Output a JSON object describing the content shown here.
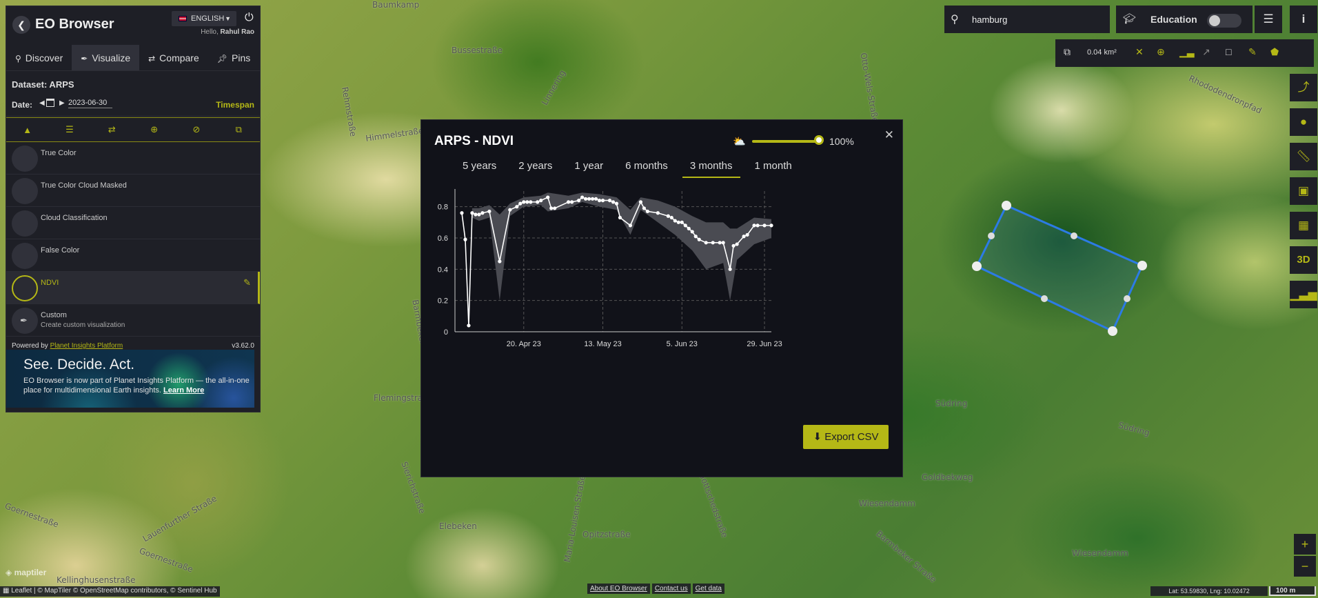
{
  "app": {
    "title": "EO Browser",
    "language": "ENGLISH",
    "greeting_prefix": "Hello,",
    "user_name": "Rahul Rao"
  },
  "tabs": [
    {
      "icon": "search-icon",
      "label": "Discover"
    },
    {
      "icon": "brush-icon",
      "label": "Visualize"
    },
    {
      "icon": "compare-icon",
      "label": "Compare"
    },
    {
      "icon": "pin-icon",
      "label": "Pins"
    }
  ],
  "dataset": {
    "label": "Dataset: ARPS"
  },
  "date": {
    "label": "Date:",
    "value": "2023-06-30",
    "timespan_label": "Timespan"
  },
  "layers": [
    {
      "name": "True Color"
    },
    {
      "name": "True Color Cloud Masked"
    },
    {
      "name": "Cloud Classification"
    },
    {
      "name": "False Color"
    },
    {
      "name": "NDVI",
      "selected": true
    },
    {
      "name": "Custom",
      "subtitle": "Create custom visualization"
    }
  ],
  "powered": {
    "prefix": "Powered by",
    "link": "Planet Insights Platform",
    "version": "v3.62.0"
  },
  "promo": {
    "headline": "See. Decide. Act.",
    "text": "EO Browser is now part of Planet Insights Platform — the all-in-one place for multidimensional Earth insights.",
    "link": "Learn More"
  },
  "search": {
    "value": "hamburg"
  },
  "education": {
    "label": "Education",
    "enabled": false
  },
  "toolbar": {
    "area": "0.04 km²"
  },
  "modal": {
    "title": "ARPS - NDVI",
    "cloud_coverage": "100%",
    "cloud_coverage_fraction": 1.0,
    "ranges": [
      "5 years",
      "2 years",
      "1 year",
      "6 months",
      "3 months",
      "1 month"
    ],
    "active_range": "3 months",
    "export_label": "Export CSV"
  },
  "chart_data": {
    "type": "line",
    "title": "",
    "xlabel": "",
    "ylabel": "",
    "ylim": [
      0,
      0.9
    ],
    "yticks": [
      "0",
      "0.2",
      "0.4",
      "0.6",
      "0.8"
    ],
    "xticks": [
      {
        "label": "20. Apr 23",
        "date": "2023-04-20"
      },
      {
        "label": "13. May 23",
        "date": "2023-05-13"
      },
      {
        "label": "5. Jun 23",
        "date": "2023-06-05"
      },
      {
        "label": "29. Jun 23",
        "date": "2023-06-29"
      }
    ],
    "xlim": [
      "2023-03-31",
      "2023-07-01"
    ],
    "grid": true,
    "series": [
      {
        "x": [
          "2023-04-02",
          "2023-04-03",
          "2023-04-04",
          "2023-04-05",
          "2023-04-06",
          "2023-04-07",
          "2023-04-08",
          "2023-04-10",
          "2023-04-13",
          "2023-04-16",
          "2023-04-18",
          "2023-04-19",
          "2023-04-20",
          "2023-04-21",
          "2023-04-22",
          "2023-04-24",
          "2023-04-25",
          "2023-04-27",
          "2023-04-28",
          "2023-04-29",
          "2023-05-03",
          "2023-05-04",
          "2023-05-06",
          "2023-05-07",
          "2023-05-08",
          "2023-05-09",
          "2023-05-10",
          "2023-05-11",
          "2023-05-12",
          "2023-05-13",
          "2023-05-15",
          "2023-05-16",
          "2023-05-17",
          "2023-05-18",
          "2023-05-21",
          "2023-05-24",
          "2023-05-25",
          "2023-05-26",
          "2023-05-29",
          "2023-06-01",
          "2023-06-02",
          "2023-06-03",
          "2023-06-04",
          "2023-06-05",
          "2023-06-06",
          "2023-06-07",
          "2023-06-08",
          "2023-06-09",
          "2023-06-10",
          "2023-06-12",
          "2023-06-14",
          "2023-06-16",
          "2023-06-17",
          "2023-06-19",
          "2023-06-20",
          "2023-06-21",
          "2023-06-23",
          "2023-06-24",
          "2023-06-26",
          "2023-06-27",
          "2023-06-29",
          "2023-07-01"
        ],
        "values": [
          0.76,
          0.59,
          0.04,
          0.76,
          0.75,
          0.75,
          0.76,
          0.77,
          0.45,
          0.78,
          0.8,
          0.82,
          0.83,
          0.83,
          0.83,
          0.83,
          0.84,
          0.86,
          0.79,
          0.79,
          0.83,
          0.83,
          0.84,
          0.86,
          0.85,
          0.85,
          0.85,
          0.85,
          0.84,
          0.84,
          0.84,
          0.83,
          0.82,
          0.73,
          0.68,
          0.83,
          0.79,
          0.77,
          0.76,
          0.74,
          0.73,
          0.71,
          0.7,
          0.7,
          0.68,
          0.66,
          0.64,
          0.61,
          0.59,
          0.57,
          0.57,
          0.57,
          0.57,
          0.4,
          0.55,
          0.56,
          0.61,
          0.62,
          0.68,
          0.68,
          0.68,
          0.68
        ]
      }
    ],
    "band": {
      "x": [
        "2023-04-02",
        "2023-04-03",
        "2023-04-04",
        "2023-04-05",
        "2023-04-07",
        "2023-04-10",
        "2023-04-13",
        "2023-04-16",
        "2023-04-20",
        "2023-04-25",
        "2023-04-27",
        "2023-05-03",
        "2023-05-07",
        "2023-05-12",
        "2023-05-17",
        "2023-05-21",
        "2023-05-24",
        "2023-05-29",
        "2023-06-03",
        "2023-06-08",
        "2023-06-12",
        "2023-06-17",
        "2023-06-19",
        "2023-06-21",
        "2023-06-26",
        "2023-07-01"
      ],
      "upper": [
        0.78,
        0.62,
        0.06,
        0.79,
        0.79,
        0.81,
        0.75,
        0.82,
        0.86,
        0.87,
        0.89,
        0.87,
        0.89,
        0.88,
        0.86,
        0.78,
        0.86,
        0.84,
        0.8,
        0.74,
        0.7,
        0.7,
        0.66,
        0.66,
        0.73,
        0.72
      ],
      "lower": [
        0.74,
        0.56,
        0.02,
        0.73,
        0.71,
        0.73,
        0.2,
        0.74,
        0.8,
        0.81,
        0.77,
        0.79,
        0.83,
        0.8,
        0.78,
        0.62,
        0.78,
        0.7,
        0.62,
        0.52,
        0.4,
        0.44,
        0.2,
        0.46,
        0.56,
        0.6
      ]
    }
  }
}
